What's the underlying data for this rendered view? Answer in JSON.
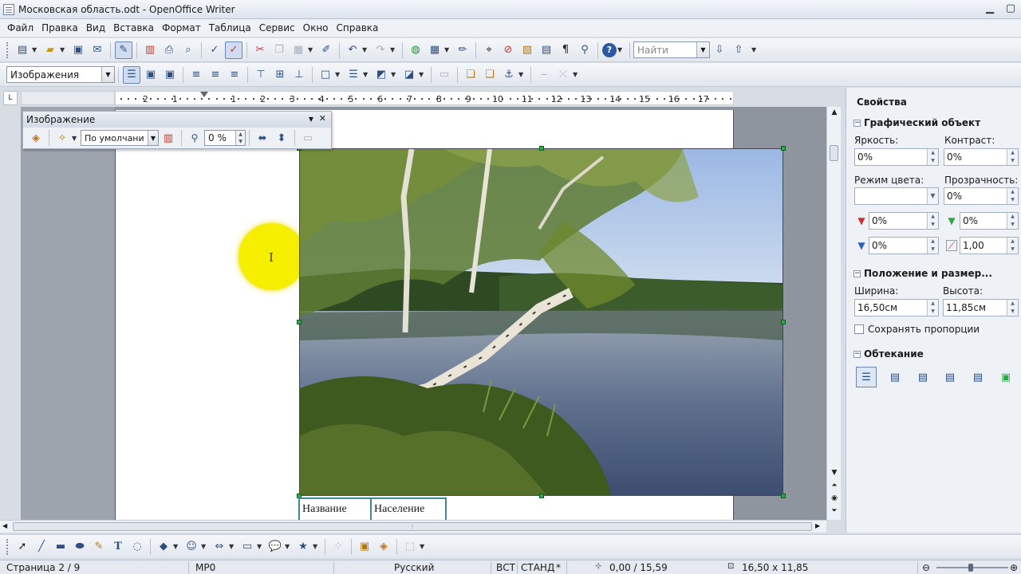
{
  "window": {
    "title": "Московская область.odt - OpenOffice Writer",
    "controls": {
      "minimize": "▁",
      "maximize": "▢"
    }
  },
  "menu": [
    "Файл",
    "Правка",
    "Вид",
    "Вставка",
    "Формат",
    "Таблица",
    "Сервис",
    "Окно",
    "Справка"
  ],
  "toolbar": {
    "find_placeholder": "Найти",
    "style_value": "Изображения"
  },
  "ruler": {
    "corner": "L",
    "marks": [
      "2",
      "1",
      "1",
      "2",
      "3",
      "4",
      "5",
      "6",
      "7",
      "8",
      "9",
      "10",
      "11",
      "12",
      "13",
      "14",
      "15",
      "16",
      "17"
    ]
  },
  "image_toolbar": {
    "title": "Изображение",
    "filter_mode": "По умолчани",
    "transparency": "0 %"
  },
  "document": {
    "table_headers": [
      "Название",
      "Население"
    ],
    "cursor_glyph": "I"
  },
  "sidebar": {
    "title": "Свойства",
    "graphic_section": "Графический объект",
    "brightness_label": "Яркость:",
    "brightness_value": "0%",
    "contrast_label": "Контраст:",
    "contrast_value": "0%",
    "color_mode_label": "Режим цвета:",
    "color_mode_value": "",
    "transparency_label": "Прозрачность:",
    "transparency_value": "0%",
    "red_value": "0%",
    "green_value": "0%",
    "blue_value": "0%",
    "gamma_value": "1,00",
    "position_section": "Положение и размер...",
    "width_label": "Ширина:",
    "width_value": "16,50см",
    "height_label": "Высота:",
    "height_value": "11,85см",
    "keep_ratio_label": "Сохранять пропорции",
    "wrap_section": "Обтекание"
  },
  "status": {
    "page": "Страница  2 / 9",
    "style": "MP0",
    "language": "Русский",
    "insert_mode": "ВСТ",
    "selection_mode": "СТАНД",
    "modified": "*",
    "position": "0,00 / 15,59",
    "size": "16,50 x 11,85"
  },
  "colors": {
    "accent": "#2ea84a",
    "table_border": "#3a8a8e",
    "highlight": "#f6ee00"
  }
}
